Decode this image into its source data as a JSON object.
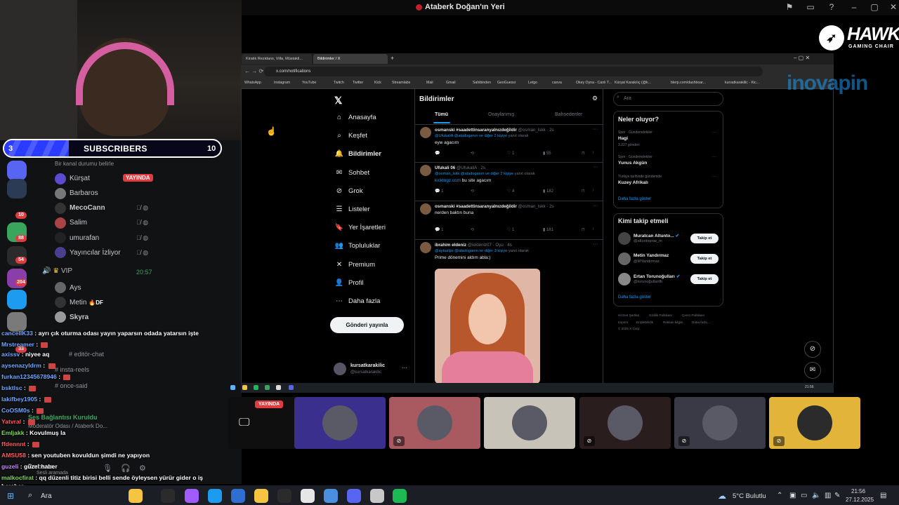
{
  "discord": {
    "window_title": "Ataberk Doğan'ın Yeri",
    "guild_badges": [
      "10",
      "88",
      "54",
      "204",
      "33"
    ],
    "status_placeholder": "Bir kanal durumu belirle",
    "voice_users": [
      {
        "name": "Kürşat",
        "live": "YAYINDA"
      },
      {
        "name": "Barbaros"
      },
      {
        "name": "MecoCann"
      },
      {
        "name": "Salim"
      },
      {
        "name": "umurafan"
      },
      {
        "name": "Yayıncılar İzliyor"
      }
    ],
    "vip_channel": "VIP",
    "vip_time": "20:57",
    "vip_users": [
      {
        "name": "Ays"
      },
      {
        "name": "Metin",
        "tag": "DF"
      },
      {
        "name": "Skyra"
      }
    ],
    "text_channels": [
      "editör-chat",
      "insta-reels",
      "once-said"
    ],
    "connection_status": "Ses Bağlantısı Kuruldu",
    "connection_channel": "Moderatör Odası / Ataberk Do...",
    "user_name": "Barbaros",
    "user_status": "Sesli aramada"
  },
  "subscribers": {
    "current": "3",
    "label": "SUBSCRIBERS",
    "goal": "10",
    "progress": 0.3
  },
  "chat": [
    {
      "user": "canceIIK33",
      "text": "ayrı çık oturma odası yayın yaparsın odada yatarsın işte",
      "color": "u"
    },
    {
      "user": "Mrstreamer",
      "text": "",
      "color": "u",
      "emote": true
    },
    {
      "user": "axissv",
      "text": "niyee aq",
      "color": "u"
    },
    {
      "user": "aysenazyldrm",
      "text": "",
      "color": "u",
      "emote": true
    },
    {
      "user": "furkan12345678946",
      "text": "",
      "color": "u",
      "emote": true
    },
    {
      "user": "bsktlsc",
      "text": "",
      "color": "u",
      "emote": true
    },
    {
      "user": "lakifbey1905",
      "text": "",
      "color": "u",
      "emote": true
    },
    {
      "user": "CoOSM0s",
      "text": "",
      "color": "u",
      "emote": true
    },
    {
      "user": "Yatvral",
      "text": "",
      "color": "r",
      "emote": true
    },
    {
      "user": "Emljakk",
      "text": "Kovulmuş la",
      "color": "g"
    },
    {
      "user": "ffdennnt",
      "text": "",
      "color": "r",
      "emote": true
    },
    {
      "user": "AMSU58",
      "text": "sen youtuben kovuldun şimdi ne yapıyon",
      "color": "r"
    },
    {
      "user": "guzeli",
      "text": "güzel haber",
      "color": "p"
    },
    {
      "user": "malkocfirat",
      "text": "qq düzenli titiz birisi belli sende öyleysen yürür gider o iş",
      "color": "g"
    },
    {
      "user": "",
      "text": "beraber",
      "color": "u"
    }
  ],
  "browser": {
    "tabs": [
      "Kiralık Rezidans, Villa, Müstakil...",
      "Bildirimler / X"
    ],
    "url": "x.com/notifications",
    "bookmarks": [
      "WhatsApp",
      "Instagram",
      "YouTube",
      "Twitch",
      "Twitter",
      "Kick",
      "Streamlabs",
      "Mail",
      "Gmail",
      "Sahibinden",
      "GeoGuessr",
      "Letgo",
      "canva",
      "Okey Oyna - Canlı T...",
      "Kürşat Karakılıç (@k...",
      "blerp.com/dashboar...",
      "kursatkarakilic - Kic..."
    ]
  },
  "x": {
    "nav": [
      {
        "label": "Anasayfa",
        "icon": "home-icon"
      },
      {
        "label": "Keşfet",
        "icon": "search-icon"
      },
      {
        "label": "Bildirimler",
        "icon": "bell-icon",
        "active": true
      },
      {
        "label": "Sohbet",
        "icon": "mail-icon"
      },
      {
        "label": "Grok",
        "icon": "grok-icon"
      },
      {
        "label": "Listeler",
        "icon": "list-icon"
      },
      {
        "label": "Yer İşaretleri",
        "icon": "bookmark-icon"
      },
      {
        "label": "Topluluklar",
        "icon": "people-icon"
      },
      {
        "label": "Premium",
        "icon": "x-icon"
      },
      {
        "label": "Profil",
        "icon": "person-icon"
      },
      {
        "label": "Daha fazla",
        "icon": "more-icon"
      }
    ],
    "post_button": "Gönderi yayınla",
    "profile_name": "kursatkarakilic",
    "profile_handle": "@kursatkarakilic",
    "page_title": "Bildirimler",
    "tabs": [
      "Tümü",
      "Onaylanmış",
      "Bahsedenler"
    ],
    "tweets": [
      {
        "name": "osmanski #saadettinsaranyaInızdeğildir",
        "handle": "@osman_lskk · 2s",
        "reply_prefix": "",
        "reply_link": "@UfukaliA @atadoganın ve diğer 2 kişiye",
        "reply_suffix": " yanıt olarak",
        "text": "eyw agacım",
        "text_link": "",
        "replies": "",
        "reposts": "",
        "likes": "1",
        "views": "55"
      },
      {
        "name": "Ufukali 06",
        "handle": "@UfukaliA · 2s",
        "reply_prefix": "",
        "reply_link": "@osman_lskk @atadoganın ve diğer 2 kişiye",
        "reply_suffix": " yanıt olarak",
        "text": "bu site agacım",
        "text_link": "kicktogz.com",
        "replies": "1",
        "reposts": "",
        "likes": "4",
        "views": "182"
      },
      {
        "name": "osmanski #saadettinsaranyaInızdeğildir",
        "handle": "@osman_lskk · 2s",
        "reply_prefix": "",
        "reply_link": "",
        "reply_suffix": "",
        "text": "nerden baktın buna",
        "text_link": "",
        "replies": "1",
        "reposts": "",
        "likes": "1",
        "views": "181"
      },
      {
        "name": "ibrahim eldeniz",
        "handle": "@ieldeniz07 · Oyu · 4s",
        "reply_prefix": "",
        "reply_link": "@aytualps @atadoganın ve diğer 3 kişiye",
        "reply_suffix": " yanıt olarak",
        "text": "Prime dönemini aldım abla:)",
        "text_link": "",
        "replies": "",
        "reposts": "",
        "likes": "",
        "views": ""
      }
    ],
    "search_placeholder": "Ara",
    "trends_title": "Neler oluyor?",
    "trends": [
      {
        "cat": "Spor · Gündemdekiler",
        "name": "Hagi",
        "count": "3.227 gönderi"
      },
      {
        "cat": "Spor · Gündemdekiler",
        "name": "Yunus Akgün",
        "count": ""
      },
      {
        "cat": "Türkiye tarihinde gündemde",
        "name": "Kuzey Afrikalı",
        "count": ""
      }
    ],
    "trends_more": "Daha fazla göster",
    "wtf_title": "Kimi takip etmeli",
    "wtf": [
      {
        "name": "Muratcan Altunto...",
        "handle": "@altuntopraк_m",
        "verified": true,
        "button": "Takip et"
      },
      {
        "name": "Metin Yandırmaz",
        "handle": "@MYandırmaz",
        "verified": false,
        "button": "Takip et"
      },
      {
        "name": "Ertan Torunoğulları",
        "handle": "@torunoğullarifb",
        "verified": true,
        "button": "Takip et"
      }
    ],
    "wtf_more": "Daha fazla göster",
    "footer": [
      "Hizmet Şartları",
      "Gizlilik Politikası",
      "Çerez Politikası",
      "Imprint",
      "Erişilebilirlik",
      "Reklam bilgisi",
      "Daha fazla ...",
      "© 2025 X Corp."
    ]
  },
  "overlay": {
    "hawk": "HAWK",
    "hawk_sub": "GAMING CHAIR",
    "inova": "inovapin"
  },
  "tiles": {
    "live_label": "YAYINDA",
    "colors": [
      "#0f0f10",
      "#3a2f8c",
      "#a85a60",
      "#c7c3b8",
      "#2a1d1d",
      "#3a3a46",
      "#e2b53a"
    ]
  },
  "taskbar": {
    "search": "Ara",
    "weather": "5°C  Bulutlu",
    "time": "21:56",
    "date": "27.12.2025",
    "inner_time": "21:56"
  }
}
